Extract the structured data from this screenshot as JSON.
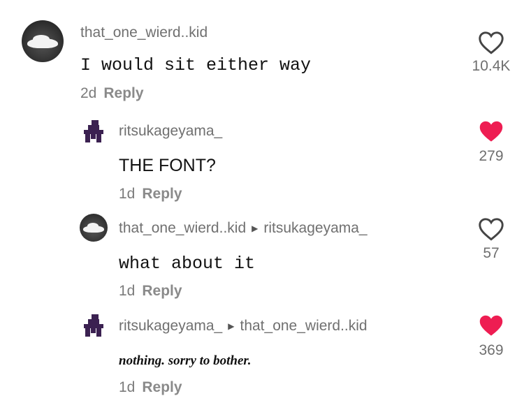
{
  "comments": [
    {
      "username": "that_one_wierd..kid",
      "reply_to": "",
      "text": "I would sit either way",
      "age": "2d",
      "reply_label": "Reply",
      "likes": "10.4K",
      "liked": false
    },
    {
      "username": "ritsukageyama_",
      "reply_to": "",
      "text": "THE FONT?",
      "age": "1d",
      "reply_label": "Reply",
      "likes": "279",
      "liked": true
    },
    {
      "username": "that_one_wierd..kid",
      "reply_to": "ritsukageyama_",
      "text": "what about it",
      "age": "1d",
      "reply_label": "Reply",
      "likes": "57",
      "liked": false
    },
    {
      "username": "ritsukageyama_",
      "reply_to": "that_one_wierd..kid",
      "text": "nothing. sorry to bother.",
      "age": "1d",
      "reply_label": "Reply",
      "likes": "369",
      "liked": true
    }
  ],
  "colors": {
    "liked_heart": "#ee1d52",
    "outline_heart": "#444444",
    "avatar_figure": "#3b2151"
  }
}
